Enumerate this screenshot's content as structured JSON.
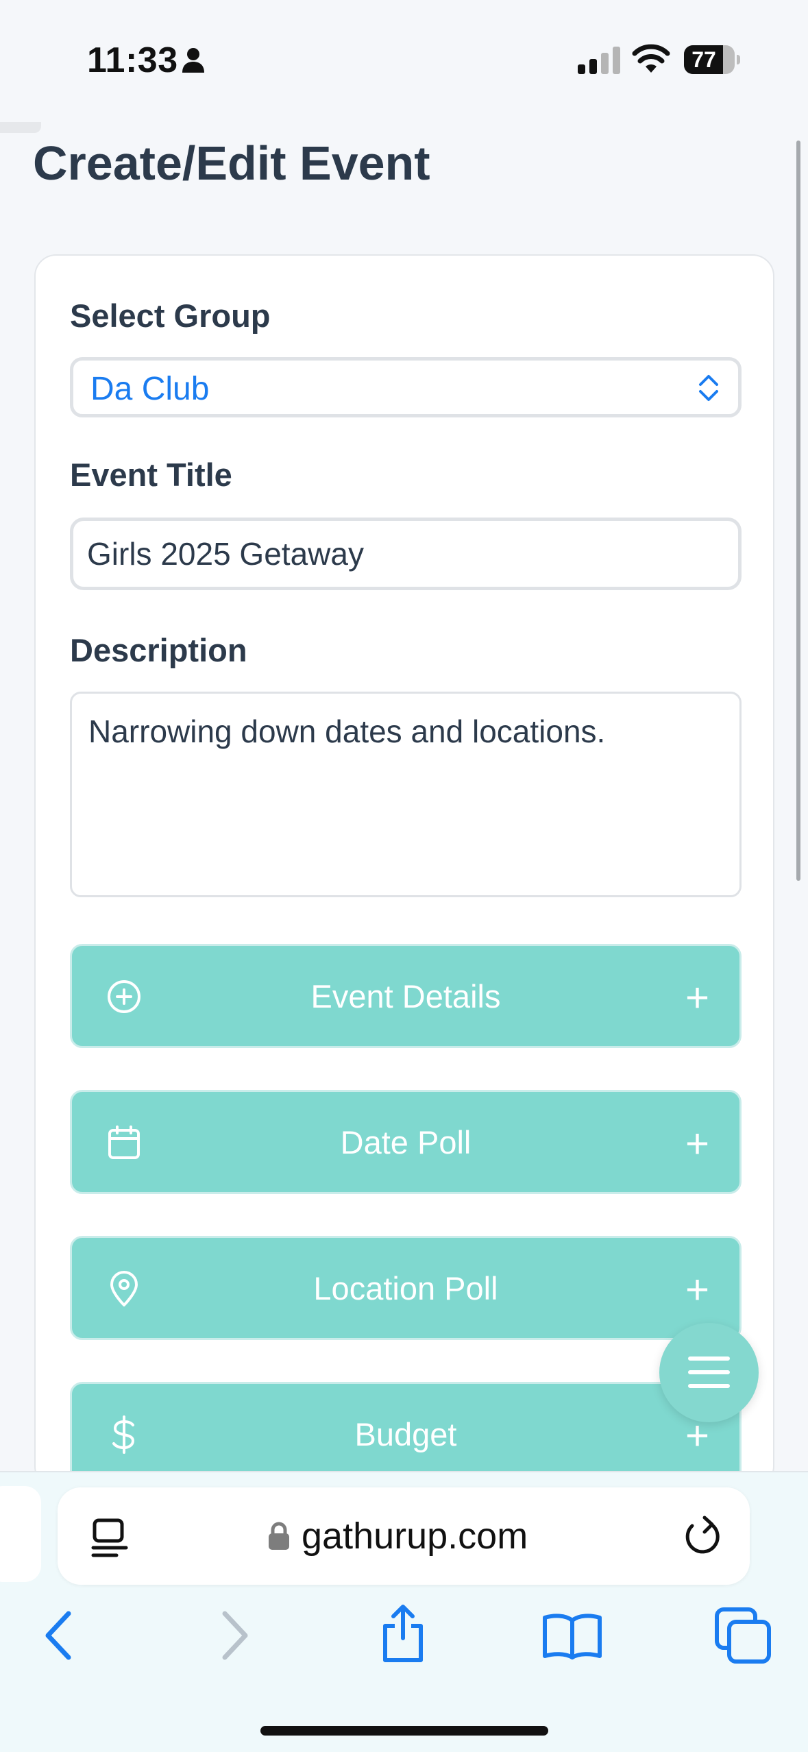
{
  "status_bar": {
    "time": "11:33",
    "battery": "77",
    "battery_level": 0.77
  },
  "page": {
    "title": "Create/Edit Event"
  },
  "form": {
    "group": {
      "label": "Select Group",
      "value": "Da Club"
    },
    "title": {
      "label": "Event Title",
      "value": "Girls 2025 Getaway"
    },
    "description": {
      "label": "Description",
      "value": "Narrowing down dates and locations."
    },
    "sections": [
      {
        "label": "Event Details",
        "icon": "plus-circle-icon"
      },
      {
        "label": "Date Poll",
        "icon": "calendar-icon"
      },
      {
        "label": "Location Poll",
        "icon": "map-pin-icon"
      },
      {
        "label": "Budget",
        "icon": "dollar-icon"
      }
    ],
    "expand_symbol": "+"
  },
  "browser": {
    "url": "gathurup.com"
  },
  "colors": {
    "accent": "#7fd8cf",
    "link": "#1a7cf0",
    "text": "#2c3a4b"
  }
}
